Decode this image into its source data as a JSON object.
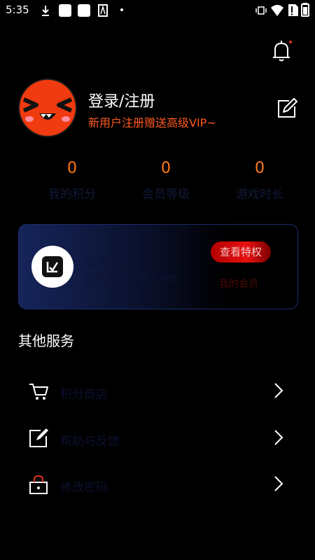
{
  "status_bar": {
    "time": "5:35"
  },
  "profile": {
    "title": "登录/注册",
    "subtitle": "新用户注册赠送高级VIP~"
  },
  "stats": [
    {
      "value": "0",
      "label": "我的积分"
    },
    {
      "value": "0",
      "label": "会员等级"
    },
    {
      "value": "0",
      "label": "游戏时长"
    }
  ],
  "vip_card": {
    "line1": "会员特权卡",
    "line2": "开通会员享受更多特权",
    "button_label": "查看特权",
    "link_label": "我的会员"
  },
  "section": {
    "title": "其他服务"
  },
  "services": [
    {
      "label": "积分商店",
      "icon": "cart-icon"
    },
    {
      "label": "帮助与反馈",
      "icon": "edit-note-icon"
    },
    {
      "label": "修改密码",
      "icon": "lock-icon"
    }
  ],
  "colors": {
    "background": "#000000",
    "accent_orange": "#ff7a1a",
    "vip_button": "#e81010",
    "avatar": "#ef3b0f"
  }
}
